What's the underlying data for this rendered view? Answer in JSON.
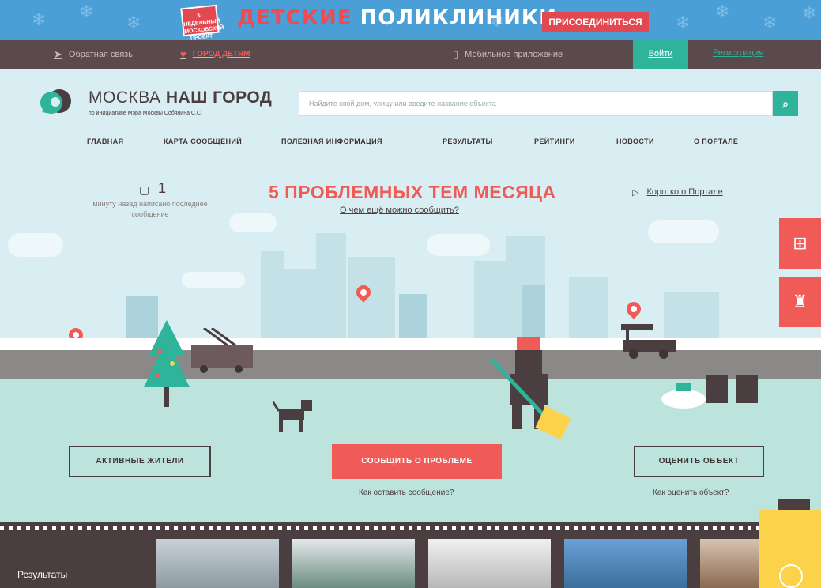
{
  "promo": {
    "badge": "3-НЕДЕЛЬНЫЙ МОСКОВСКИЙ ПРОЕКТ",
    "title_part1": "ДЕТСКИЕ",
    "title_part2": "ПОЛИКЛИНИКИ",
    "join_label": "ПРИСОЕДИНИТЬСЯ"
  },
  "topbar": {
    "feedback": "Обратная связь",
    "kids_city": "ГОРОД ДЕТЯМ",
    "mobile_app": "Мобильное приложение",
    "login": "Войти",
    "register": "Регистрация"
  },
  "header": {
    "logo_light": "МОСКВА ",
    "logo_bold": "НАШ ГОРОД",
    "logo_sub": "по инициативе Мэра Москвы Собянина С.С.",
    "search_placeholder": "Найдите свой дом, улицу или введите название объекта"
  },
  "nav": [
    "ГЛАВНАЯ",
    "КАРТА СООБЩЕНИЙ",
    "ПОЛЕЗНАЯ ИНФОРМАЦИЯ",
    "РЕЗУЛЬТАТЫ",
    "РЕЙТИНГИ",
    "НОВОСТИ",
    "О ПОРТАЛЕ"
  ],
  "hero": {
    "counter_value": "1",
    "counter_text": "минуту назад написано последнее сообщение",
    "headline": "5 ПРОБЛЕМНЫХ ТЕМ МЕСЯЦА",
    "subhead": "О чем ещё можно сообщить?",
    "about": "Коротко о Портале",
    "btn_active": "АКТИВНЫЕ ЖИТЕЛИ",
    "btn_report": "СООБЩИТЬ О ПРОБЛЕМЕ",
    "btn_rate": "ОЦЕНИТЬ ОБЪЕКТ",
    "link_how_report": "Как оставить сообщение?",
    "link_how_rate": "Как оценить объект?"
  },
  "results": {
    "label": "Результаты"
  },
  "colors": {
    "accent_red": "#f15b57",
    "accent_green": "#2fb39b",
    "dark": "#4a3e40",
    "sky": "#d9eef3"
  }
}
